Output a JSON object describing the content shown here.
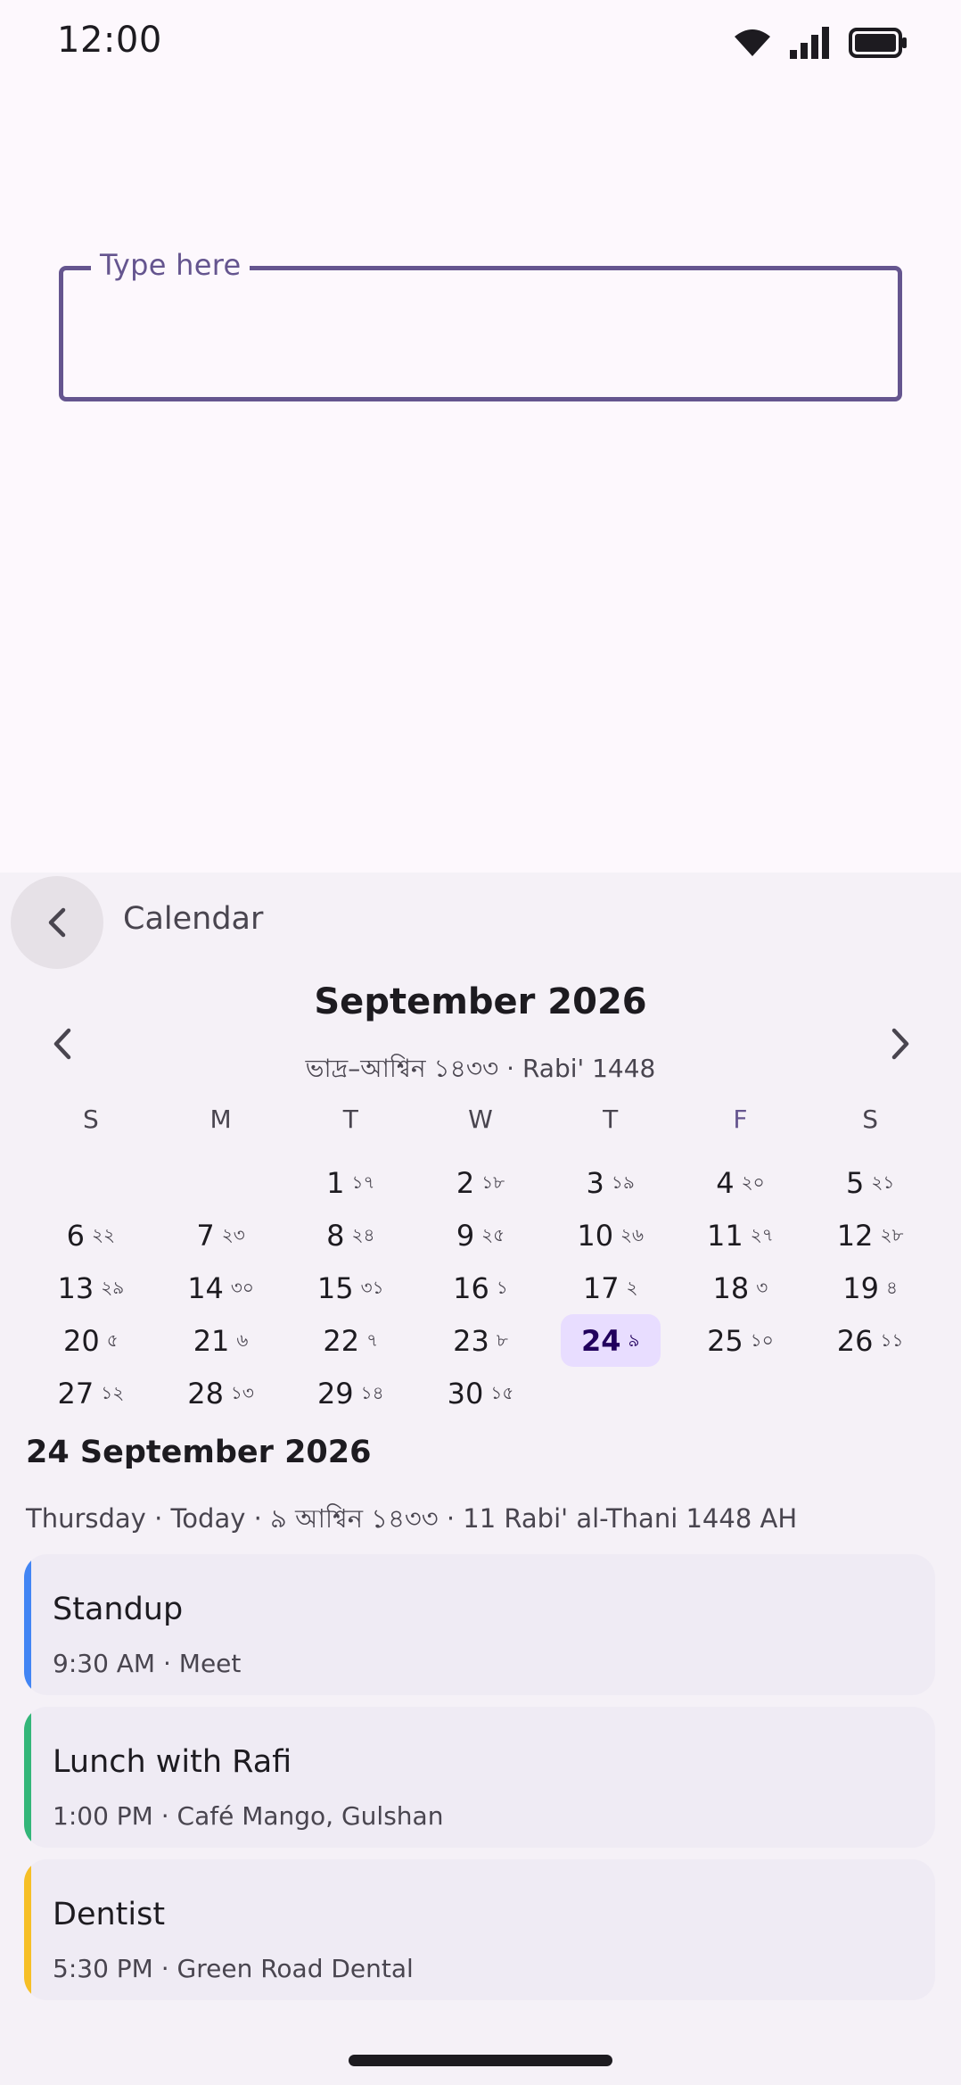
{
  "status_bar": {
    "time": "12:00"
  },
  "input": {
    "label": "Type here",
    "value": ""
  },
  "sheet": {
    "title": "Calendar"
  },
  "calendar": {
    "month_title": "September 2026",
    "subtitle": "ভাদ্র–আশ্বিন ১৪৩৩  ·  Rabi' 1448",
    "weekdays": [
      "S",
      "M",
      "T",
      "W",
      "T",
      "F",
      "S"
    ],
    "days": [
      {
        "d": "1",
        "bn": "১৭"
      },
      {
        "d": "2",
        "bn": "১৮"
      },
      {
        "d": "3",
        "bn": "১৯"
      },
      {
        "d": "4",
        "bn": "২০"
      },
      {
        "d": "5",
        "bn": "২১"
      },
      {
        "d": "6",
        "bn": "২২"
      },
      {
        "d": "7",
        "bn": "২৩"
      },
      {
        "d": "8",
        "bn": "২৪"
      },
      {
        "d": "9",
        "bn": "২৫"
      },
      {
        "d": "10",
        "bn": "২৬"
      },
      {
        "d": "11",
        "bn": "২৭"
      },
      {
        "d": "12",
        "bn": "২৮"
      },
      {
        "d": "13",
        "bn": "২৯"
      },
      {
        "d": "14",
        "bn": "৩০"
      },
      {
        "d": "15",
        "bn": "৩১"
      },
      {
        "d": "16",
        "bn": "১"
      },
      {
        "d": "17",
        "bn": "২"
      },
      {
        "d": "18",
        "bn": "৩"
      },
      {
        "d": "19",
        "bn": "৪"
      },
      {
        "d": "20",
        "bn": "৫"
      },
      {
        "d": "21",
        "bn": "৬"
      },
      {
        "d": "22",
        "bn": "৭"
      },
      {
        "d": "23",
        "bn": "৮"
      },
      {
        "d": "24",
        "bn": "৯"
      },
      {
        "d": "25",
        "bn": "১০"
      },
      {
        "d": "26",
        "bn": "১১"
      },
      {
        "d": "27",
        "bn": "১২"
      },
      {
        "d": "28",
        "bn": "১৩"
      },
      {
        "d": "29",
        "bn": "১৪"
      },
      {
        "d": "30",
        "bn": "১৫"
      }
    ],
    "selected_day": "24"
  },
  "detail": {
    "date": "24 September 2026",
    "meta": "Thursday · Today · ৯ আশ্বিন ১৪৩৩ · 11 Rabi' al-Thani 1448 AH"
  },
  "events": [
    {
      "title": "Standup",
      "subtitle": "9:30 AM · Meet",
      "color": "#4285f4"
    },
    {
      "title": "Lunch with Rafi",
      "subtitle": "1:00 PM · Café Mango, Gulshan",
      "color": "#33b679"
    },
    {
      "title": "Dentist",
      "subtitle": "5:30 PM · Green Road Dental",
      "color": "#f6bf26"
    }
  ],
  "colors": {
    "accent": "#65558f",
    "selected_bg": "#e8ddff",
    "background": "#fdf8fd",
    "sheet": "#f5f1f7"
  }
}
